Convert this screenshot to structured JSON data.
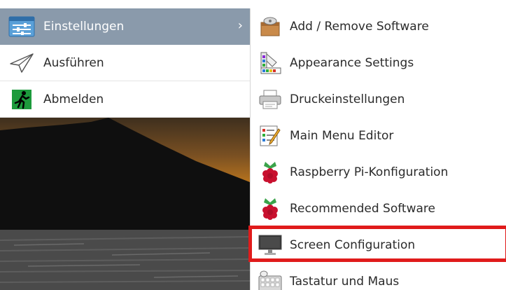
{
  "main_menu": {
    "items": [
      {
        "label": "Einstellungen",
        "icon": "settings-sliders-icon",
        "selected": true
      },
      {
        "label": "Ausführen",
        "icon": "paper-plane-icon",
        "selected": false
      },
      {
        "label": "Abmelden",
        "icon": "running-exit-icon",
        "selected": false
      }
    ],
    "chevron": "›"
  },
  "submenu": {
    "items": [
      {
        "label": "Add / Remove Software",
        "icon": "package-box-icon"
      },
      {
        "label": "Appearance Settings",
        "icon": "color-palette-icon"
      },
      {
        "label": "Druckeinstellungen",
        "icon": "printer-icon"
      },
      {
        "label": "Main Menu Editor",
        "icon": "menu-editor-icon"
      },
      {
        "label": "Raspberry Pi-Konfiguration",
        "icon": "raspberry-icon"
      },
      {
        "label": "Recommended Software",
        "icon": "raspberry-icon"
      },
      {
        "label": "Screen Configuration",
        "icon": "monitor-icon"
      },
      {
        "label": "Tastatur und Maus",
        "icon": "keyboard-mouse-icon"
      }
    ]
  },
  "colors": {
    "selected_row": "#8a9aab",
    "highlight": "#e01b1b"
  }
}
